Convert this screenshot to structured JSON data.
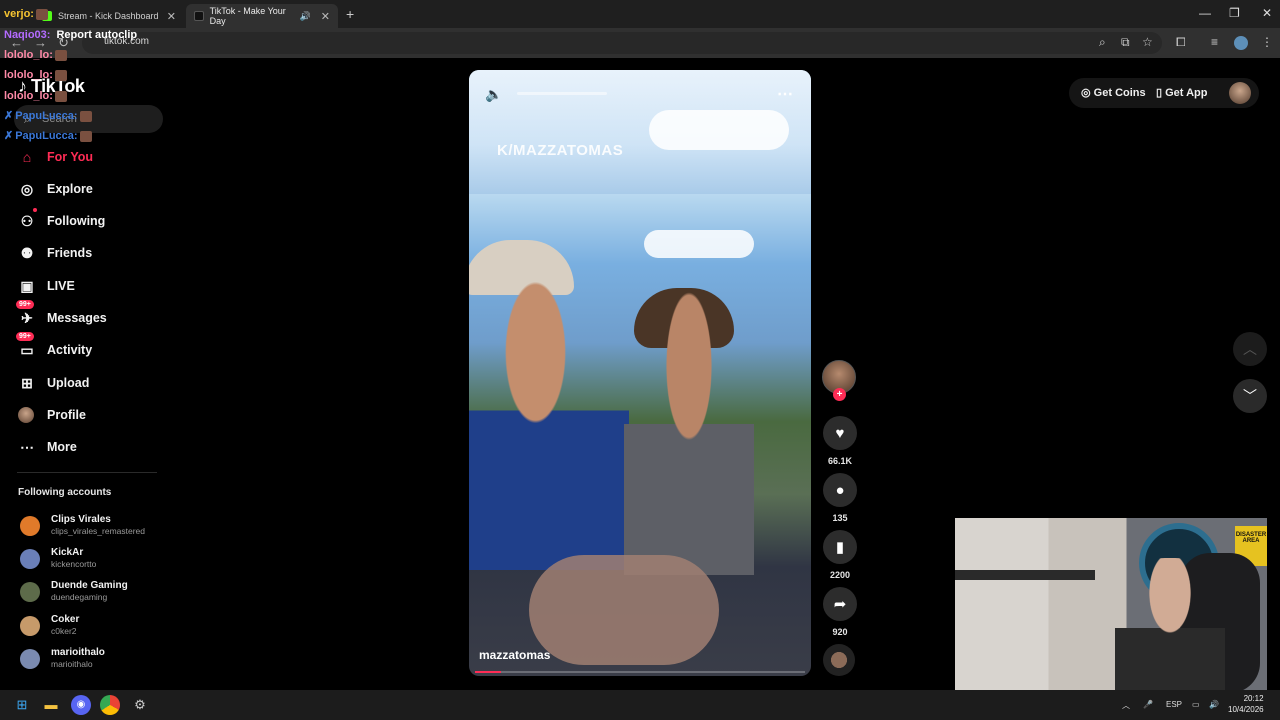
{
  "browser": {
    "tabs": [
      {
        "title": "Stream - Kick Dashboard",
        "active": false
      },
      {
        "title": "TikTok - Make Your Day",
        "active": true
      }
    ],
    "url": "tiktok.com"
  },
  "chat_overlay": [
    {
      "user": "verjo:",
      "color": "#f7c531",
      "message": ""
    },
    {
      "user": "Naqio03:",
      "color": "#b46bff",
      "message": "Report autoclip"
    },
    {
      "user": "lololo_lo:",
      "color": "#ff8aa8",
      "message": ""
    },
    {
      "user": "lololo_lo:",
      "color": "#ff8aa8",
      "message": ""
    },
    {
      "user": "lololo_lo:",
      "color": "#ff8aa8",
      "message": ""
    },
    {
      "user": "PapuLucca:",
      "color": "#3b78d8",
      "message": ""
    },
    {
      "user": "PapuLucca:",
      "color": "#3b78d8",
      "message": ""
    }
  ],
  "sidebar": {
    "logo": "TikTok",
    "search_placeholder": "Search",
    "items": [
      {
        "label": "For You",
        "icon": "home-icon",
        "active": true
      },
      {
        "label": "Explore",
        "icon": "compass-icon"
      },
      {
        "label": "Following",
        "icon": "user-follow-icon"
      },
      {
        "label": "Friends",
        "icon": "friends-icon"
      },
      {
        "label": "LIVE",
        "icon": "live-tv-icon"
      },
      {
        "label": "Messages",
        "icon": "messages-icon",
        "badge": "99+"
      },
      {
        "label": "Activity",
        "icon": "activity-icon",
        "badge": "99+"
      },
      {
        "label": "Upload",
        "icon": "upload-icon"
      },
      {
        "label": "Profile",
        "icon": "profile-avatar-icon"
      },
      {
        "label": "More",
        "icon": "more-dots-icon"
      }
    ],
    "following_title": "Following accounts",
    "following": [
      {
        "name": "Clips Virales",
        "handle": "clips_virales_remastered",
        "color": "#e07a2a"
      },
      {
        "name": "KickAr",
        "handle": "kickencortto",
        "color": "#6a7fb8"
      },
      {
        "name": "Duende Gaming",
        "handle": "duendegaming",
        "color": "#5d6b4a"
      },
      {
        "name": "Coker",
        "handle": "c0ker2",
        "color": "#c69a6a"
      },
      {
        "name": "marioithalo",
        "handle": "marioithalo",
        "color": "#7a8ab0"
      }
    ]
  },
  "video": {
    "watermark": "K/MAZZATOMAS",
    "author": "mazzatomas",
    "progress": 0.08
  },
  "actions": {
    "likes": "66.1K",
    "comments": "135",
    "saves": "2200",
    "shares": "920"
  },
  "topbar": {
    "get_coins": "Get Coins",
    "get_app": "Get App"
  },
  "webcam": {
    "sign_text": "DISASTER AREA"
  },
  "taskbar": {
    "lang": "ESP",
    "time": "20:12",
    "date": "10/4/2026"
  }
}
